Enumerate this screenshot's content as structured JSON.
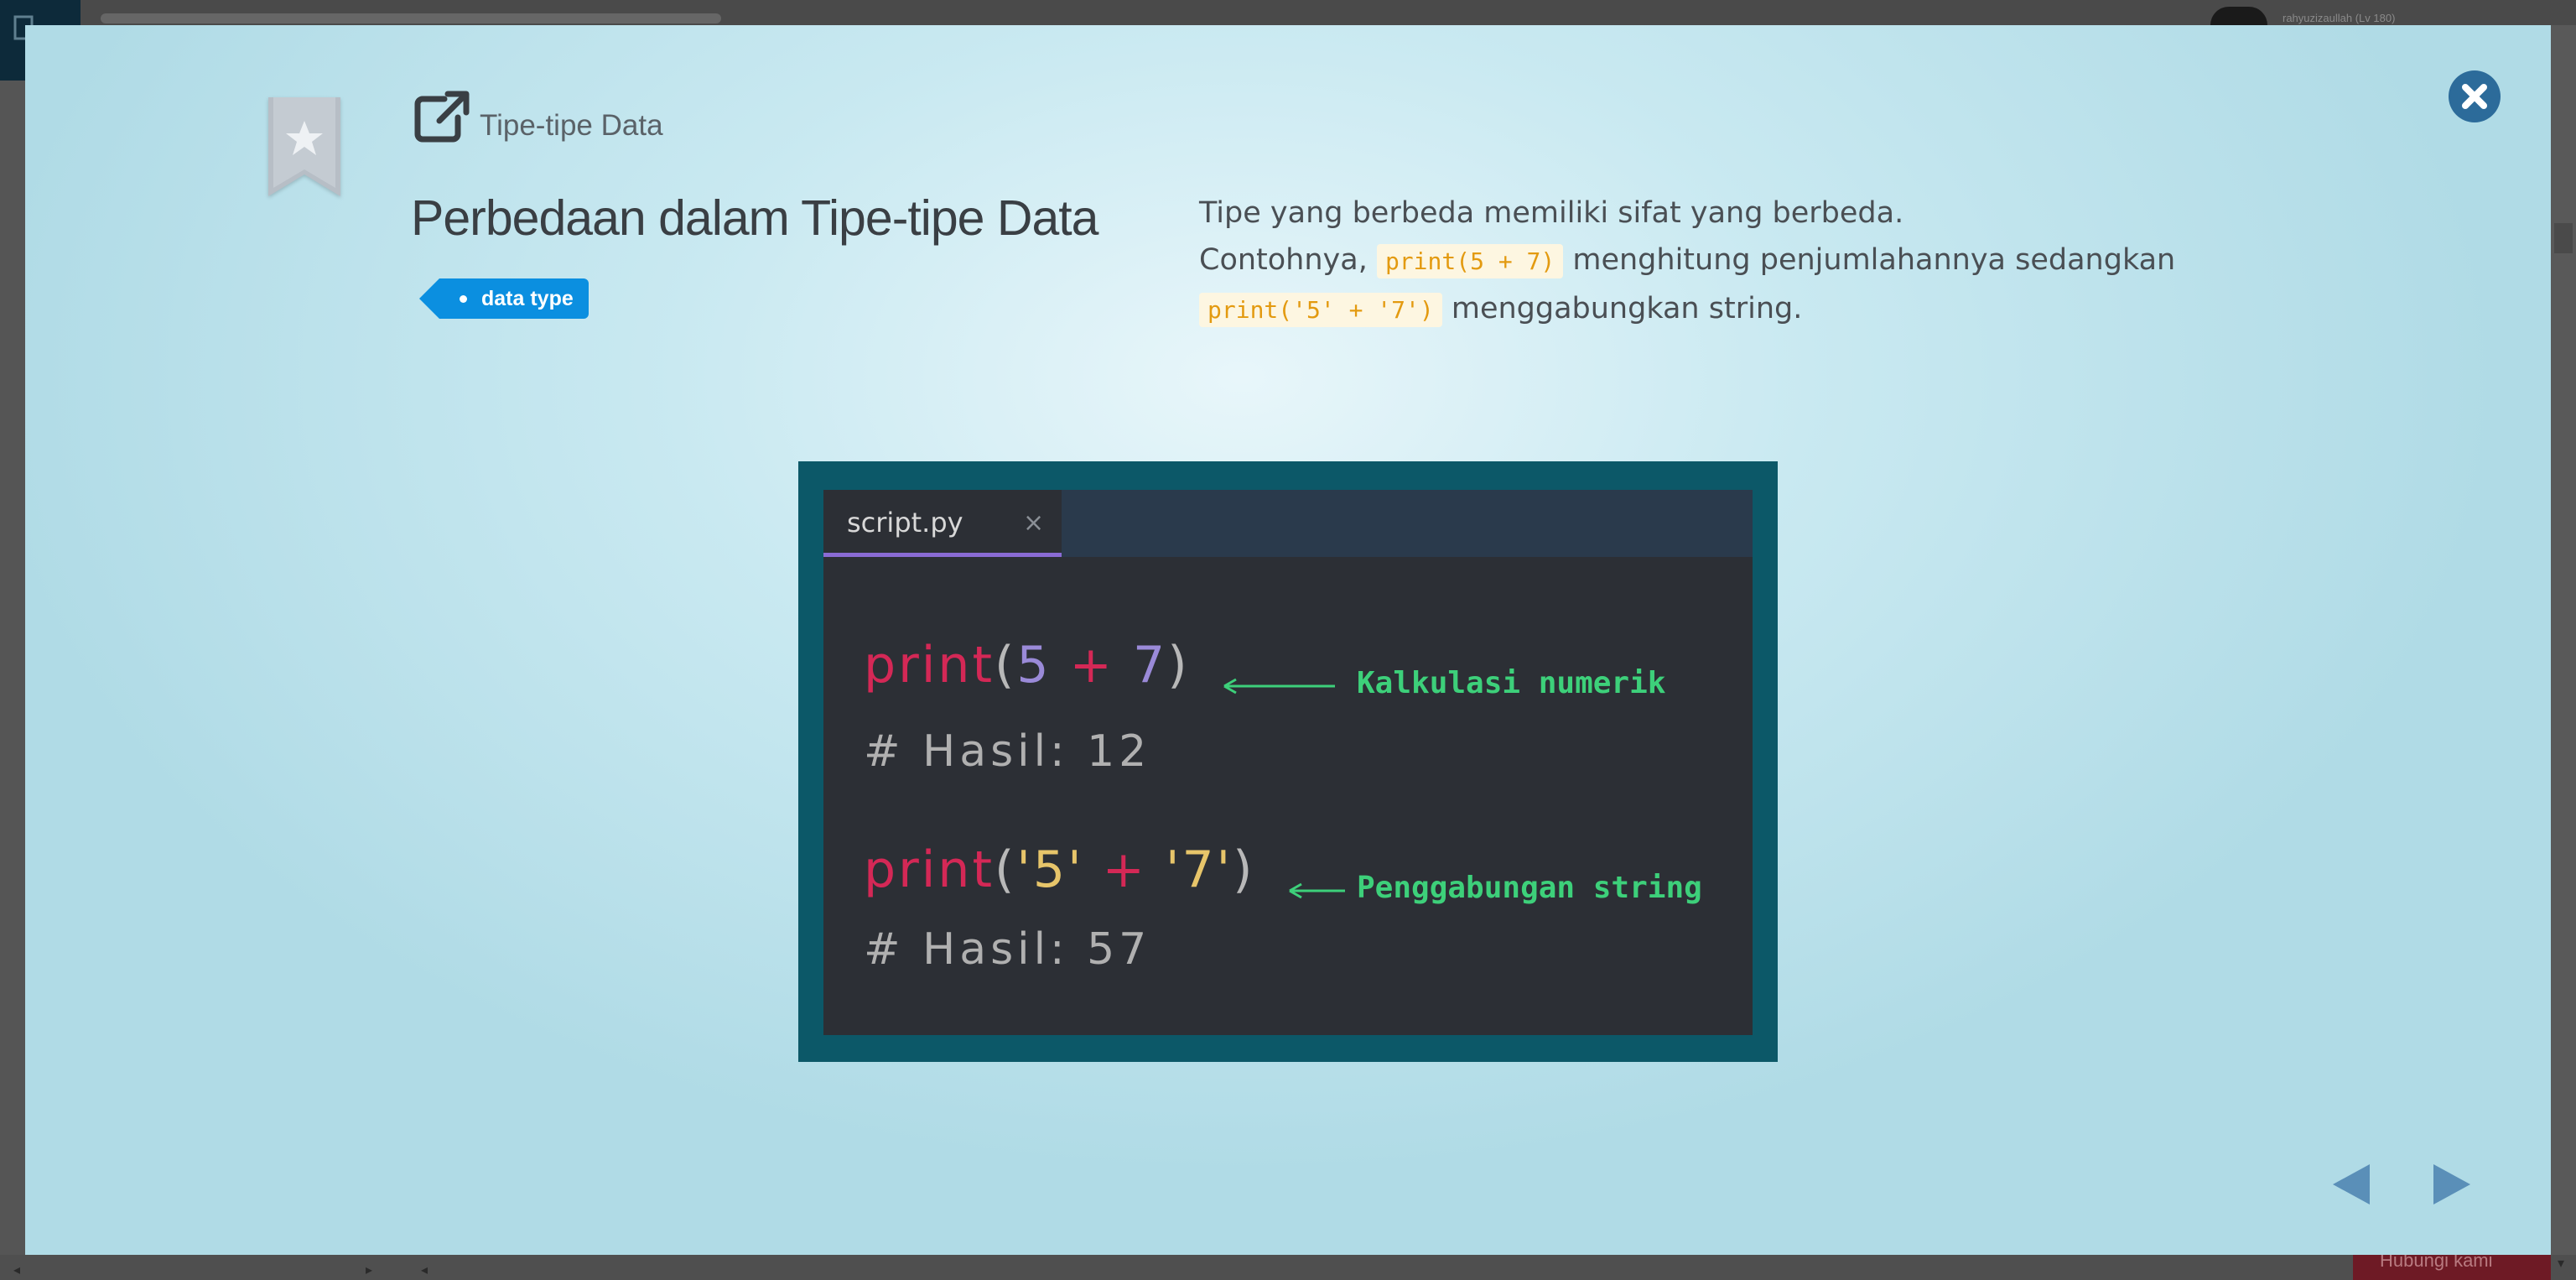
{
  "background": {
    "username": "rahyuzizaullah (Lv 180)",
    "cta_label": "Hubungi kami"
  },
  "modal": {
    "section_label": "Tipe-tipe Data",
    "title": "Perbedaan dalam Tipe-tipe Data",
    "tag": "data type",
    "description": {
      "line1": "Tipe yang berbeda memiliki sifat yang berbeda.",
      "line2_before": "Contohnya, ",
      "code1": "print(5 + 7)",
      "line2_after": " menghitung penjumlahannya sedangkan",
      "code2": "print('5' + '7')",
      "line3_after": " menggabungkan string."
    }
  },
  "illustration": {
    "tab_name": "script.py",
    "tab_close": "×",
    "code1": {
      "fn": "print",
      "open": "(",
      "a": "5",
      "op": " + ",
      "b": "7",
      "close": ")"
    },
    "comment1": "# Hasil: 12",
    "annotation1": "Kalkulasi numerik",
    "code2": {
      "fn": "print",
      "open": "(",
      "a": "'5'",
      "op": " + ",
      "b": "'7'",
      "close": ")"
    },
    "comment2": "# Hasil: 57",
    "annotation2": "Penggabungan string"
  },
  "icons": {
    "bookmark": "bookmark-star-icon",
    "external": "external-link-icon",
    "close": "close-icon",
    "prev": "previous-arrow-icon",
    "next": "next-arrow-icon"
  },
  "colors": {
    "tag_blue": "#0b8fe0",
    "close_blue": "#2c6b9a",
    "nav_blue": "#5a8fb8",
    "code_chip_text": "#e39a10",
    "annotation_green": "#3dd07a"
  }
}
